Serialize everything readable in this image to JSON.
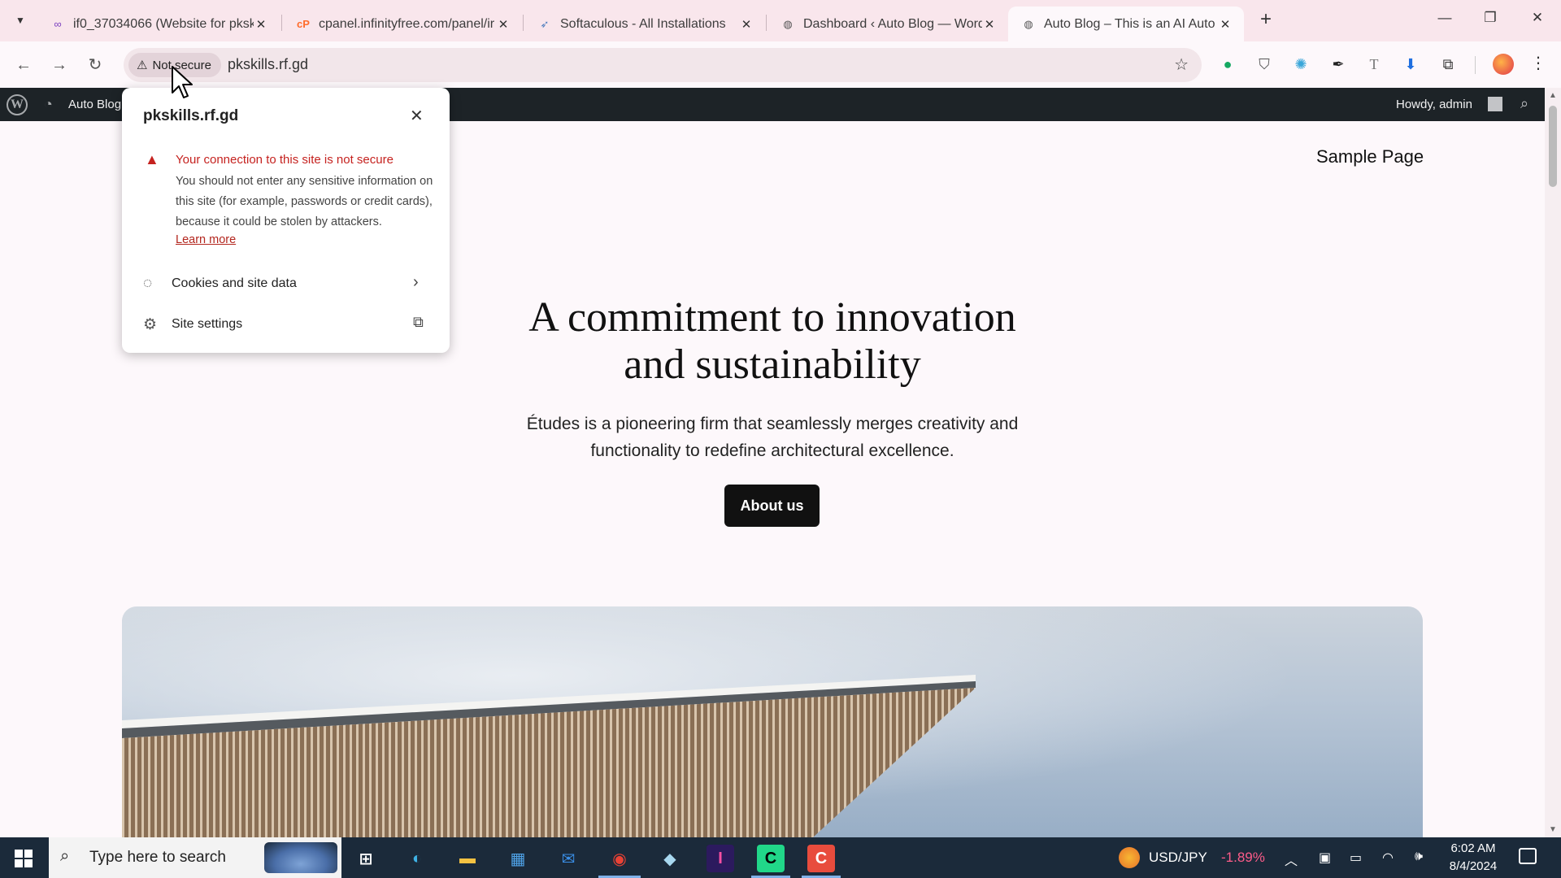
{
  "tabs": [
    {
      "title": "if0_37034066 (Website for pksk",
      "icon": "infinity-icon",
      "active": false
    },
    {
      "title": "cpanel.infinityfree.com/panel/ir",
      "icon": "cpanel-icon",
      "active": false
    },
    {
      "title": "Softaculous - All Installations",
      "icon": "softaculous-icon",
      "active": false
    },
    {
      "title": "Dashboard ‹ Auto Blog — Word",
      "icon": "globe-icon",
      "active": false
    },
    {
      "title": "Auto Blog – This is an AI Auto B",
      "icon": "globe-icon",
      "active": true
    }
  ],
  "toolbar": {
    "security_chip": "Not secure",
    "url": "pkskills.rf.gd"
  },
  "adminbar": {
    "site_name": "Auto Blog",
    "howdy": "Howdy, admin"
  },
  "page": {
    "nav_link": "Sample Page",
    "hero_title_line1": "A commitment to innovation",
    "hero_title_line2": "and sustainability",
    "hero_text_line1": "Études is a pioneering firm that seamlessly merges creativity and",
    "hero_text_line2": "functionality to redefine architectural excellence.",
    "about_button": "About us"
  },
  "popup": {
    "host": "pkskills.rf.gd",
    "warning_title": "Your connection to this site is not secure",
    "warning_body": "You should not enter any sensitive information on this site (for example, passwords or credit cards), because it could be stolen by attackers.",
    "learn_more": "Learn more",
    "rows": [
      {
        "label": "Cookies and site data",
        "icon": "cookie-icon",
        "trail": "chevron-right-icon"
      },
      {
        "label": "Site settings",
        "icon": "gear-icon",
        "trail": "external-link-icon"
      }
    ]
  },
  "taskbar": {
    "search_placeholder": "Type here to search",
    "ticker_symbol": "USD/JPY",
    "ticker_change": "-1.89%",
    "time": "6:02 AM",
    "date": "8/4/2024"
  },
  "colors": {
    "warning_red": "#c5221f",
    "tabstrip_bg": "#f9e6ec",
    "adminbar_bg": "#1d2327",
    "taskbar_bg": "#1b2a3a"
  }
}
